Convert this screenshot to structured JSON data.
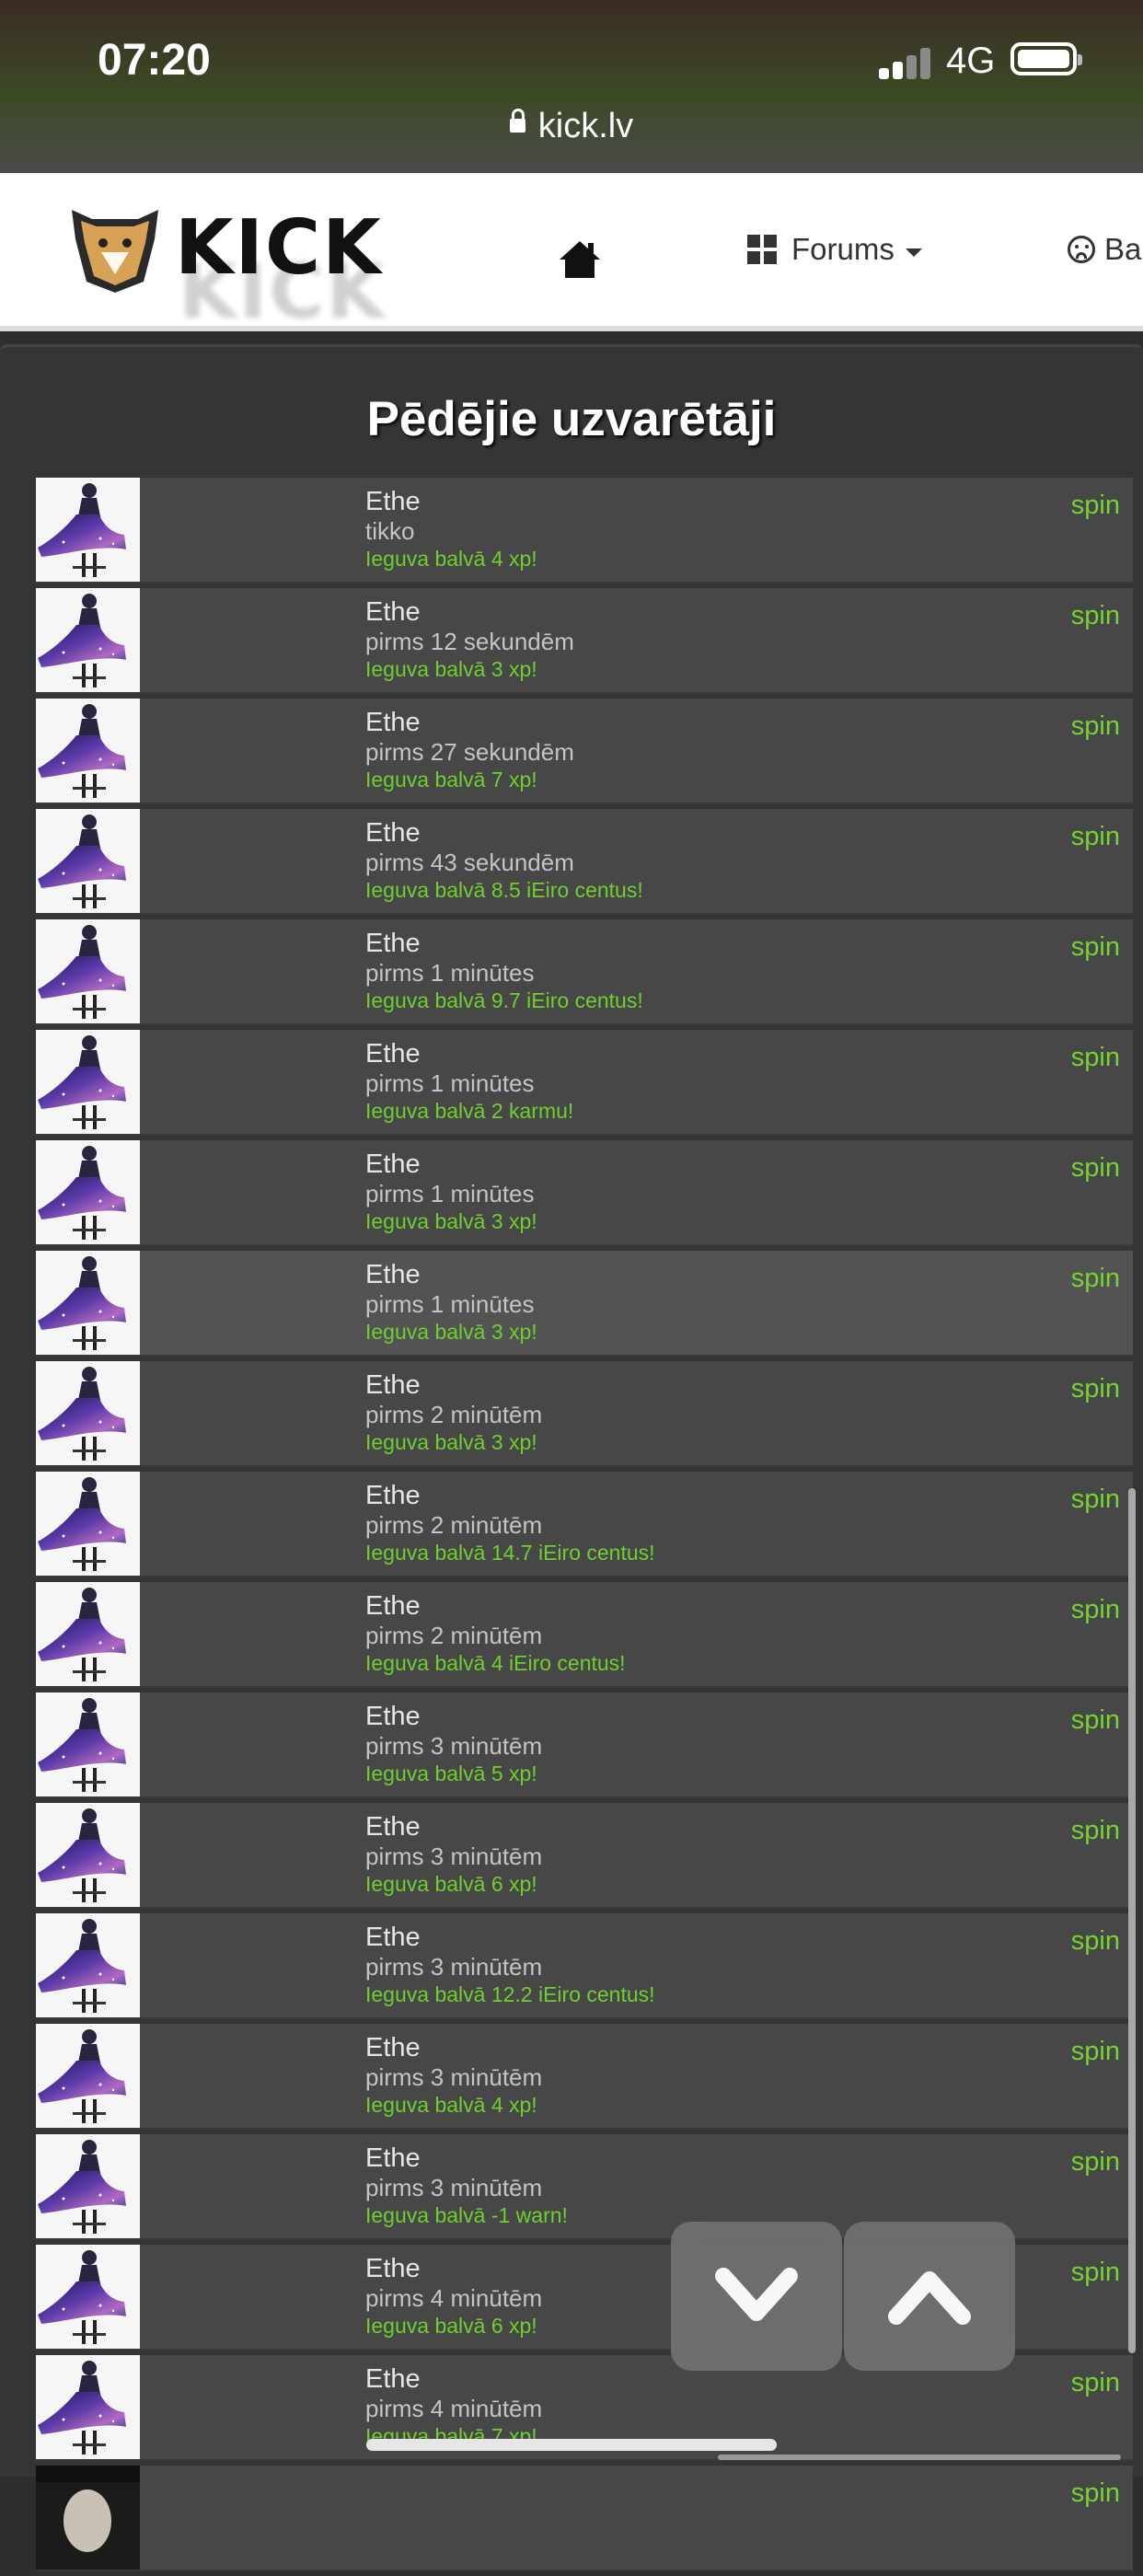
{
  "status_bar": {
    "time": "07:20",
    "network": "4G",
    "url": "kick.lv"
  },
  "nav": {
    "logo_text": "KICK",
    "forums_label": "Forums",
    "more_label": "Ba"
  },
  "main": {
    "heading": "Pēdējie uzvarētāji",
    "rows": [
      {
        "user": "Ethe",
        "time": "tikko",
        "prize": "Ieguva balvā 4 xp!",
        "action": "spin"
      },
      {
        "user": "Ethe",
        "time": "pirms 12 sekundēm",
        "prize": "Ieguva balvā 3 xp!",
        "action": "spin"
      },
      {
        "user": "Ethe",
        "time": "pirms 27 sekundēm",
        "prize": "Ieguva balvā 7 xp!",
        "action": "spin"
      },
      {
        "user": "Ethe",
        "time": "pirms 43 sekundēm",
        "prize": "Ieguva balvā 8.5 iEiro centus!",
        "action": "spin"
      },
      {
        "user": "Ethe",
        "time": "pirms 1 minūtes",
        "prize": "Ieguva balvā 9.7 iEiro centus!",
        "action": "spin"
      },
      {
        "user": "Ethe",
        "time": "pirms 1 minūtes",
        "prize": "Ieguva balvā 2 karmu!",
        "action": "spin"
      },
      {
        "user": "Ethe",
        "time": "pirms 1 minūtes",
        "prize": "Ieguva balvā 3 xp!",
        "action": "spin"
      },
      {
        "user": "Ethe",
        "time": "pirms 1 minūtes",
        "prize": "Ieguva balvā 3 xp!",
        "action": "spin"
      },
      {
        "user": "Ethe",
        "time": "pirms 2 minūtēm",
        "prize": "Ieguva balvā 3 xp!",
        "action": "spin"
      },
      {
        "user": "Ethe",
        "time": "pirms 2 minūtēm",
        "prize": "Ieguva balvā 14.7 iEiro centus!",
        "action": "spin"
      },
      {
        "user": "Ethe",
        "time": "pirms 2 minūtēm",
        "prize": "Ieguva balvā 4 iEiro centus!",
        "action": "spin"
      },
      {
        "user": "Ethe",
        "time": "pirms 3 minūtēm",
        "prize": "Ieguva balvā 5 xp!",
        "action": "spin"
      },
      {
        "user": "Ethe",
        "time": "pirms 3 minūtēm",
        "prize": "Ieguva balvā 6 xp!",
        "action": "spin"
      },
      {
        "user": "Ethe",
        "time": "pirms 3 minūtēm",
        "prize": "Ieguva balvā 12.2 iEiro centus!",
        "action": "spin"
      },
      {
        "user": "Ethe",
        "time": "pirms 3 minūtēm",
        "prize": "Ieguva balvā 4 xp!",
        "action": "spin"
      },
      {
        "user": "Ethe",
        "time": "pirms 3 minūtēm",
        "prize": "Ieguva balvā -1 warn!",
        "action": "spin"
      },
      {
        "user": "Ethe",
        "time": "pirms 4 minūtēm",
        "prize": "Ieguva balvā 6 xp!",
        "action": "spin"
      },
      {
        "user": "Ethe",
        "time": "pirms 4 minūtēm",
        "prize": "Ieguva balvā 7 xp!",
        "action": "spin"
      }
    ],
    "partial_row": {
      "action": "spin"
    }
  },
  "icons": {
    "home": "home-icon",
    "forums": "grid-icon",
    "scroll_down": "chevron-down-icon",
    "scroll_up": "chevron-up-icon"
  },
  "colors": {
    "accent_green": "#6ed02e",
    "panel": "#353535",
    "row": "#474747"
  }
}
